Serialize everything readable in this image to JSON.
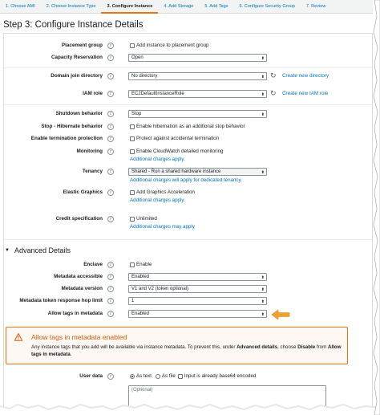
{
  "wizard": {
    "tabs": [
      "1. Choose AMI",
      "2. Choose Instance Type",
      "3. Configure Instance",
      "4. Add Storage",
      "5. Add Tags",
      "6. Configure Security Group",
      "7. Review"
    ],
    "active_index": 2
  },
  "page": {
    "title": "Step 3: Configure Instance Details"
  },
  "info_glyph": "i",
  "fields": {
    "placement_group": {
      "label": "Placement group",
      "checkbox_label": "Add instance to placement group"
    },
    "capacity_reservation": {
      "label": "Capacity Reservation",
      "value": "Open"
    },
    "domain_join": {
      "label": "Domain join directory",
      "value": "No directory",
      "link": "Create new directory"
    },
    "iam_role": {
      "label": "IAM role",
      "value": "EC2DefaultInstanceRole",
      "link": "Create new IAM role"
    },
    "shutdown": {
      "label": "Shutdown behavior",
      "value": "Stop"
    },
    "hibernate": {
      "label": "Stop - Hibernate behavior",
      "checkbox_label": "Enable hibernation as an additional stop behavior"
    },
    "termination": {
      "label": "Enable termination protection",
      "checkbox_label": "Protect against accidental termination"
    },
    "monitoring": {
      "label": "Monitoring",
      "checkbox_label": "Enable CloudWatch detailed monitoring",
      "note": "Additional charges apply."
    },
    "tenancy": {
      "label": "Tenancy",
      "value": "Shared - Run a shared hardware instance",
      "note": "Additional charges will apply for dedicated tenancy."
    },
    "elastic_graphics": {
      "label": "Elastic Graphics",
      "checkbox_label": "Add Graphics Acceleration",
      "note": "Additional charges apply."
    },
    "credit_spec": {
      "label": "Credit specification",
      "checkbox_label": "Unlimited",
      "note": "Additional charges may apply"
    }
  },
  "advanced": {
    "heading": "Advanced Details",
    "enclave": {
      "label": "Enclave",
      "checkbox_label": "Enable"
    },
    "metadata_accessible": {
      "label": "Metadata accessible",
      "value": "Enabled"
    },
    "metadata_version": {
      "label": "Metadata version",
      "value": "V1 and V2 (token optional)"
    },
    "hop_limit": {
      "label": "Metadata token response hop limit",
      "value": "1"
    },
    "allow_tags": {
      "label": "Allow tags in metadata",
      "value": "Enabled"
    }
  },
  "warning": {
    "title": "Allow tags in metadata enabled",
    "text_1": "Any instance tags that you add will be available via instance metadata. To prevent this, under ",
    "bold_1": "Advanced details",
    "text_2": ", choose ",
    "bold_2": "Disable",
    "text_3": " from ",
    "bold_3": "Allow tags in metadata",
    "text_4": "."
  },
  "user_data": {
    "label": "User data",
    "option_text": "As text",
    "option_file": "As file",
    "base64_label": "Input is already base64 encoded",
    "placeholder": "(Optional)"
  },
  "colors": {
    "accent": "#ec7211",
    "link": "#0073bb",
    "warning_bg": "#fef8f4"
  },
  "icons": [
    "info-icon",
    "chevron-down-icon",
    "refresh-icon",
    "caret-down-icon",
    "warning-icon",
    "arrow-left-icon"
  ]
}
